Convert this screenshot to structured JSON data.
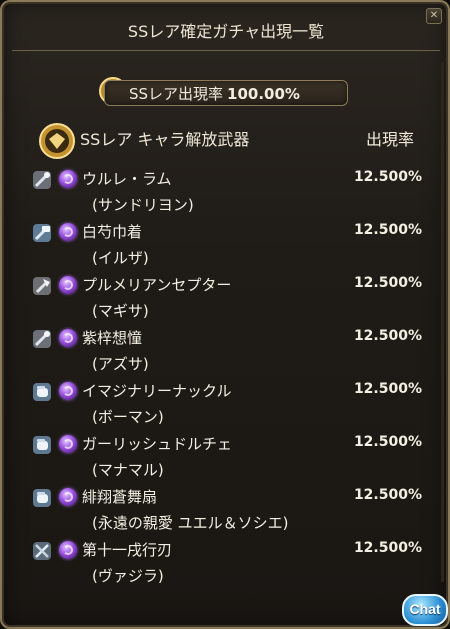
{
  "window": {
    "title": "SSレア確定ガチャ出現一覧"
  },
  "rate_box": {
    "label": "SSレア出現率",
    "value": "100.00%"
  },
  "list": {
    "header_label": "SSレア キャラ解放武器",
    "header_rate": "出現率",
    "items": [
      {
        "name": "ウルレ・ラム",
        "character": "(サンドリヨン)",
        "rate": "12.500%",
        "icon": "staff-icon"
      },
      {
        "name": "白芍巾着",
        "character": "(イルザ)",
        "rate": "12.500%",
        "icon": "hammer-icon"
      },
      {
        "name": "プルメリアンセプター",
        "character": "(マギサ)",
        "rate": "12.500%",
        "icon": "axe-icon"
      },
      {
        "name": "紫梓想憧",
        "character": "(アズサ)",
        "rate": "12.500%",
        "icon": "staff-icon"
      },
      {
        "name": "イマジナリーナックル",
        "character": "(ボーマン)",
        "rate": "12.500%",
        "icon": "fist-icon"
      },
      {
        "name": "ガーリッシュドルチェ",
        "character": "(マナマル)",
        "rate": "12.500%",
        "icon": "fist-icon"
      },
      {
        "name": "緋翔蒼舞扇",
        "character": "(永遠の親愛 ユエル＆ソシエ)",
        "rate": "12.500%",
        "icon": "fist-icon"
      },
      {
        "name": "第十一戌行刃",
        "character": "(ヴァジラ)",
        "rate": "12.500%",
        "icon": "swords-icon"
      }
    ]
  },
  "chat": {
    "label": "Chat"
  },
  "colors": {
    "panel_bg": "#1f1b17",
    "border": "#8a7a57",
    "text": "#f4efe3",
    "element_dark": "#9a4fe0",
    "chat_blue": "#2c8fd4"
  }
}
